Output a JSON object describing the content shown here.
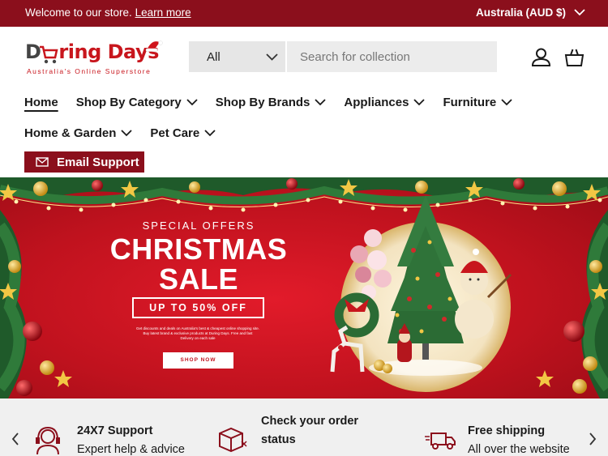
{
  "topbar": {
    "welcome_text": "Welcome to our store.",
    "learn_more": "Learn more",
    "region": "Australia (AUD $)"
  },
  "logo": {
    "word_part1": "D",
    "word_part2": "ring Days",
    "tagline": "Australia's  Online  Superstore"
  },
  "search": {
    "category_value": "All",
    "placeholder": "Search for collection"
  },
  "nav": {
    "items": [
      {
        "label": "Home"
      },
      {
        "label": "Shop By Category"
      },
      {
        "label": "Shop By Brands"
      },
      {
        "label": "Appliances"
      },
      {
        "label": "Furniture"
      },
      {
        "label": "Home & Garden"
      },
      {
        "label": "Pet Care"
      }
    ],
    "email_support": "Email Support"
  },
  "banner": {
    "special": "SPECIAL OFFERS",
    "title_line1": "CHRISTMAS",
    "title_line2": "SALE",
    "offer": "UP TO 50% OFF",
    "description": "Get discounts and deals on Australia's best & cheapest online shopping site. Buy latest brand & exclusive products at During Days. Free and fast Delivery on each sale",
    "shop_now": "SHOP NOW"
  },
  "features": [
    {
      "title": "24X7 Support",
      "subtitle": "Expert help & advice",
      "icon": "headset-icon"
    },
    {
      "title": "Check your order",
      "subtitle": "status",
      "icon": "package-icon"
    },
    {
      "title": "Free shipping",
      "subtitle": "All over the website",
      "icon": "truck-icon"
    }
  ],
  "colors": {
    "brand": "#8b0f1c",
    "banner_red": "#c0121e",
    "gold": "#d4a62a"
  }
}
